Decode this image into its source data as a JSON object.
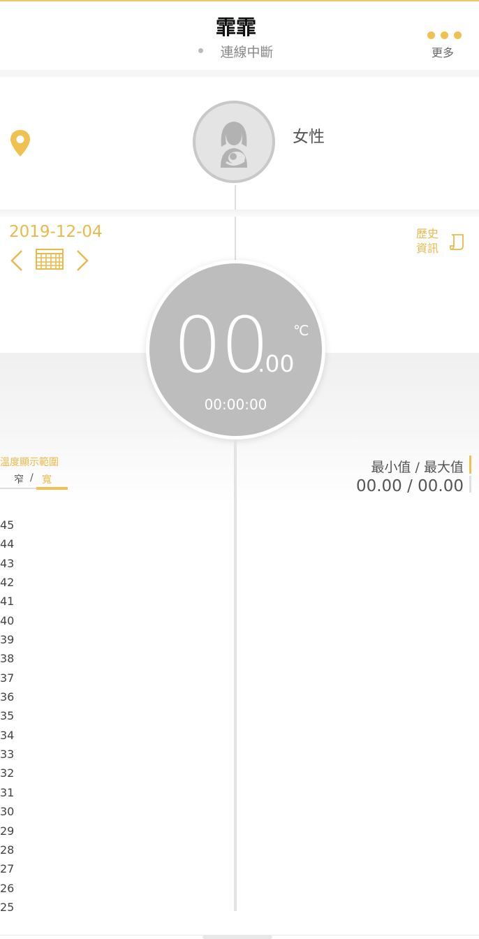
{
  "header": {
    "title": "霏霏",
    "status": "連線中斷",
    "more_label": "更多"
  },
  "profile": {
    "gender": "女性",
    "icons": {
      "location": "location-pin-icon",
      "avatar": "mother-baby-avatar-icon"
    }
  },
  "date_nav": {
    "date": "2019-12-04",
    "icons": [
      "chevron-left-icon",
      "calendar-icon",
      "chevron-right-icon"
    ]
  },
  "history": {
    "label_line1": "歷史",
    "label_line2": "資訊",
    "icon": "document-icon"
  },
  "temperature": {
    "integer": "00",
    "decimal": ".00",
    "unit": "℃",
    "time": "00:00:00"
  },
  "range": {
    "title": "溫度顯示範圍",
    "narrow": "窄",
    "separator": "/",
    "wide": "寬",
    "selected": "寬"
  },
  "minmax": {
    "label": "最小值 / 最大值",
    "value": "00.00 / 00.00"
  },
  "scale": [
    "45",
    "44",
    "43",
    "42",
    "41",
    "40",
    "39",
    "38",
    "37",
    "36",
    "35",
    "34",
    "33",
    "32",
    "31",
    "30",
    "29",
    "28",
    "27",
    "26",
    "25"
  ],
  "colors": {
    "accent": "#f0c050",
    "accent_text": "#e9b94a",
    "dial": "#bdbdbd",
    "avatar_bg": "#e4e4e4"
  }
}
